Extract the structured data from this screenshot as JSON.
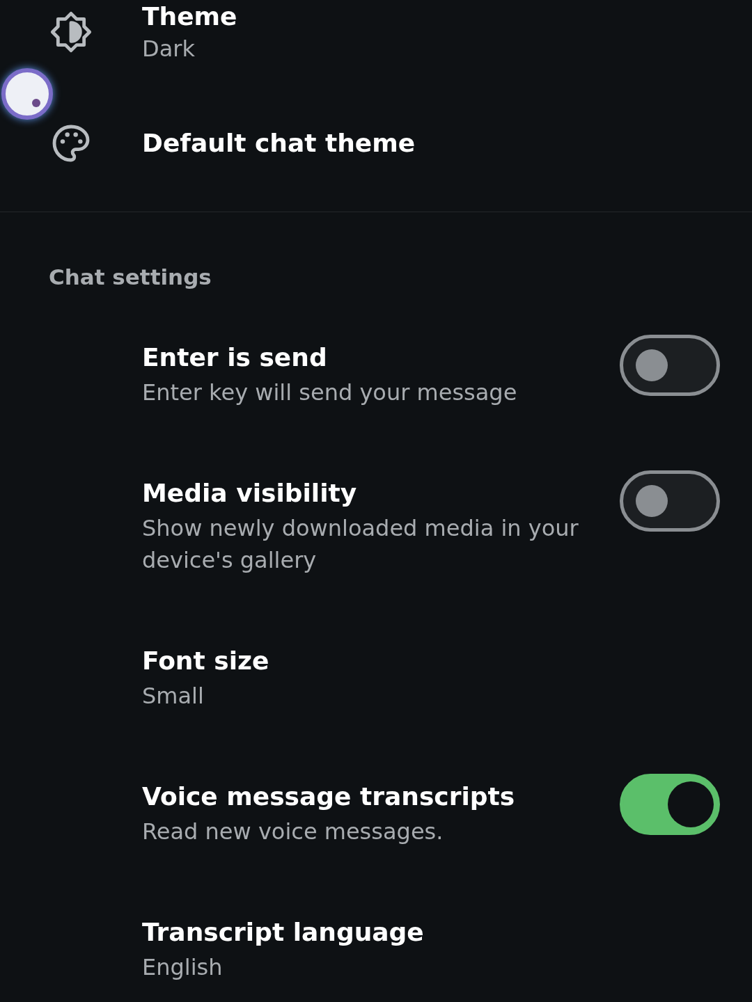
{
  "display_items": [
    {
      "kind": "theme",
      "title": "Theme",
      "subtitle": "Dark"
    },
    {
      "kind": "palette",
      "title": "Default chat theme"
    }
  ],
  "section_title": "Chat settings",
  "chat_items": [
    {
      "kind": "switch",
      "title": "Enter is send",
      "subtitle": "Enter key will send your message",
      "on": false
    },
    {
      "kind": "switch",
      "title": "Media visibility",
      "subtitle": "Show newly downloaded media in your device's gallery",
      "on": false
    },
    {
      "kind": "plain",
      "title": "Font size",
      "subtitle": "Small"
    },
    {
      "kind": "switch",
      "title": "Voice message transcripts",
      "subtitle": "Read new voice messages.",
      "on": true
    },
    {
      "kind": "plain",
      "title": "Transcript language",
      "subtitle": "English"
    }
  ]
}
